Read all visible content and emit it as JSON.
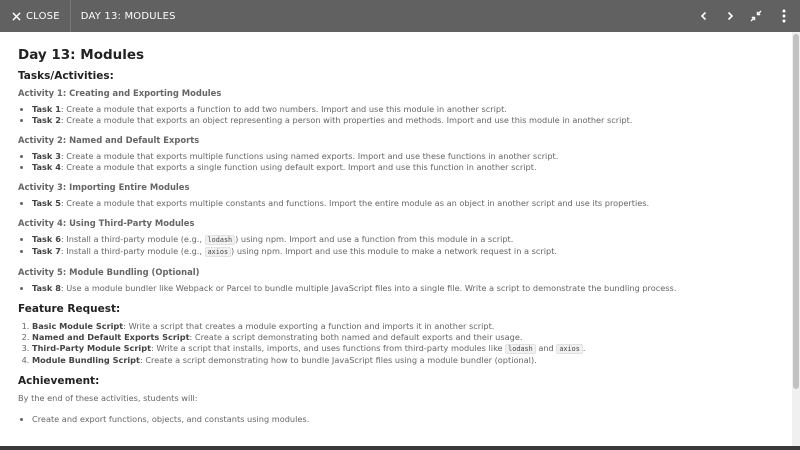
{
  "topbar": {
    "close_label": "CLOSE",
    "title": "DAY 13: MODULES",
    "icons": [
      "chevron-left-icon",
      "chevron-right-icon",
      "collapse-icon",
      "more-vertical-icon"
    ]
  },
  "doc": {
    "title": "Day 13: Modules",
    "tasks_heading": "Tasks/Activities:",
    "activities": [
      {
        "heading": "Activity 1: Creating and Exporting Modules",
        "tasks": [
          {
            "label": "Task 1",
            "text": "Create a module that exports a function to add two numbers. Import and use this module in another script."
          },
          {
            "label": "Task 2",
            "text": "Create a module that exports an object representing a person with properties and methods. Import and use this module in another script."
          }
        ]
      },
      {
        "heading": "Activity 2: Named and Default Exports",
        "tasks": [
          {
            "label": "Task 3",
            "text": "Create a module that exports multiple functions using named exports. Import and use these functions in another script."
          },
          {
            "label": "Task 4",
            "text": "Create a module that exports a single function using default export. Import and use this function in another script."
          }
        ]
      },
      {
        "heading": "Activity 3: Importing Entire Modules",
        "tasks": [
          {
            "label": "Task 5",
            "text": "Create a module that exports multiple constants and functions. Import the entire module as an object in another script and use its properties."
          }
        ]
      },
      {
        "heading": "Activity 4: Using Third-Party Modules",
        "tasks": [
          {
            "label": "Task 6",
            "text_before": "Install a third-party module (e.g., ",
            "code": "lodash",
            "text_after": ") using npm. Import and use a function from this module in a script."
          },
          {
            "label": "Task 7",
            "text_before": "Install a third-party module (e.g., ",
            "code": "axios",
            "text_after": ") using npm. Import and use this module to make a network request in a script."
          }
        ]
      },
      {
        "heading": "Activity 5: Module Bundling (Optional)",
        "tasks": [
          {
            "label": "Task 8",
            "text": "Use a module bundler like Webpack or Parcel to bundle multiple JavaScript files into a single file. Write a script to demonstrate the bundling process."
          }
        ]
      }
    ],
    "feature_heading": "Feature Request:",
    "features": [
      {
        "label": "Basic Module Script",
        "text": "Write a script that creates a module exporting a function and imports it in another script."
      },
      {
        "label": "Named and Default Exports Script",
        "text": "Create a script demonstrating both named and default exports and their usage."
      },
      {
        "label": "Third-Party Module Script",
        "text_before": "Write a script that installs, imports, and uses functions from third-party modules like ",
        "code1": "lodash",
        "text_mid": " and ",
        "code2": "axios",
        "text_after": "."
      },
      {
        "label": "Module Bundling Script",
        "text": "Create a script demonstrating how to bundle JavaScript files using a module bundler (optional)."
      }
    ],
    "achievement_heading": "Achievement:",
    "achievement_intro": "By the end of these activities, students will:",
    "achievements": [
      "Create and export functions, objects, and constants using modules."
    ]
  },
  "colors": {
    "topbar_bg": "#616161",
    "heading_text": "#222222",
    "body_text": "#666666"
  }
}
